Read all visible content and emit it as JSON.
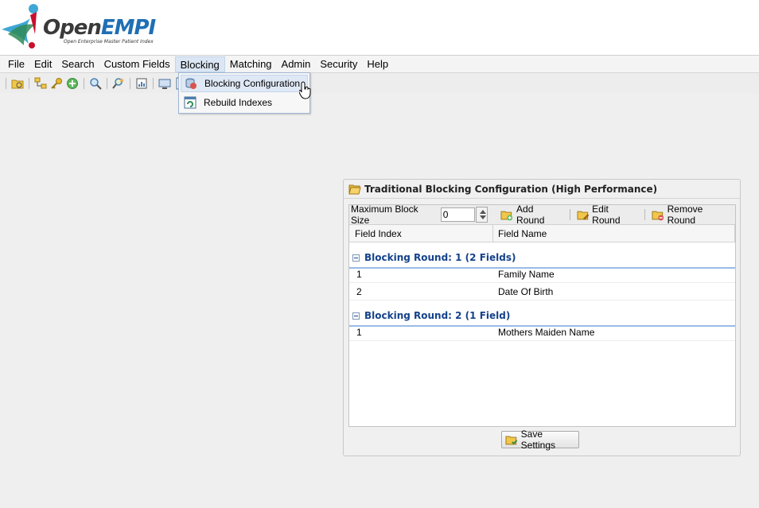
{
  "logo": {
    "brand_open": "Open",
    "brand_empi": "EMPI",
    "tagline": "Open Enterprise Master Patient Index"
  },
  "menubar": {
    "items": [
      "File",
      "Edit",
      "Search",
      "Custom Fields",
      "Blocking",
      "Matching",
      "Admin",
      "Security",
      "Help"
    ],
    "active": "Blocking"
  },
  "toolbar": {
    "icons": [
      "folder-icon",
      "hierarchy-icon",
      "key-icon",
      "add-icon",
      "search-icon",
      "search-star-icon",
      "report-icon",
      "monitor-icon",
      "document-icon"
    ]
  },
  "dropdown": {
    "items": [
      {
        "label": "Blocking Configuration",
        "icon": "database-icon",
        "highlighted": true
      },
      {
        "label": "Rebuild Indexes",
        "icon": "refresh-table-icon",
        "highlighted": false
      }
    ]
  },
  "panel": {
    "title": "Traditional Blocking Configuration (High Performance)",
    "max_block_size_label": "Maximum Block Size",
    "max_block_size_value": "0",
    "add_round": "Add Round",
    "edit_round": "Edit Round",
    "remove_round": "Remove Round",
    "columns": [
      "Field Index",
      "Field Name"
    ],
    "groups": [
      {
        "title": "Blocking Round: 1 (2 Fields)",
        "rows": [
          {
            "index": "1",
            "name": "Family Name"
          },
          {
            "index": "2",
            "name": "Date Of Birth"
          }
        ]
      },
      {
        "title": "Blocking Round: 2 (1 Field)",
        "rows": [
          {
            "index": "1",
            "name": "Mothers Maiden Name"
          }
        ]
      }
    ],
    "save_label": "Save Settings"
  },
  "colors": {
    "group_text": "#15428b",
    "group_line": "#99bbe8",
    "brand_blue": "#1f6fb5"
  }
}
